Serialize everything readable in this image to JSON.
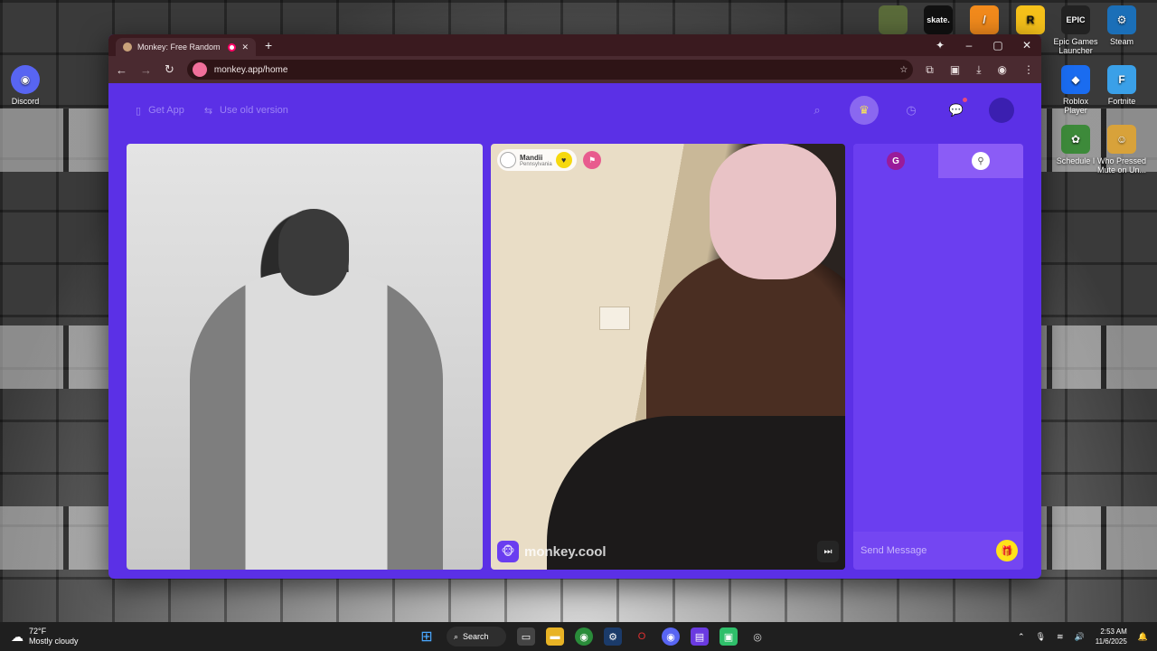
{
  "desktop": {
    "icons_left": [
      {
        "label": "Discord",
        "icon": "discord-icon",
        "color": "#5865f2"
      }
    ],
    "icons_right_top": [
      {
        "label": "",
        "icon": "game-thumbnail-icon",
        "color": "#5a6b3a"
      },
      {
        "label": "",
        "icon": "skate-icon",
        "color": "#111111"
      },
      {
        "label": "",
        "icon": "orange-game-icon",
        "color": "#f28a1c"
      },
      {
        "label": "",
        "icon": "rockstar-icon",
        "color": "#f6c11a"
      },
      {
        "label": "Epic Games Launcher",
        "icon": "epic-games-icon",
        "color": "#222222"
      },
      {
        "label": "Steam",
        "icon": "steam-icon",
        "color": "#1b6fb8"
      }
    ],
    "icons_right_mid": [
      {
        "label": "Roblox Player",
        "icon": "roblox-icon",
        "color": "#1a6cf0"
      },
      {
        "label": "Fortnite",
        "icon": "fortnite-icon",
        "color": "#3aa0e8"
      }
    ],
    "icons_right_low": [
      {
        "label": "Schedule I",
        "icon": "schedule-icon",
        "color": "#3d8a3a"
      },
      {
        "label": "Who Pressed Mute on Un...",
        "icon": "mute-game-icon",
        "color": "#d8a23a"
      }
    ]
  },
  "browser": {
    "tab_title": "Monkey: Free Random Vid",
    "new_tab_glyph": "+",
    "url": "monkey.app/home",
    "window_controls": {
      "minimize": "–",
      "maximize": "▢",
      "close": "✕"
    }
  },
  "app": {
    "header": {
      "get_app": "Get App",
      "old_version": "Use old version"
    },
    "remote_user": {
      "name": "Mandii",
      "location": "Pennsylvania"
    },
    "brand": "monkey.cool",
    "chat": {
      "tab_letter": "G",
      "placeholder": "Send Message"
    },
    "colors": {
      "accent": "#5b30e6",
      "gift": "#ffe21a"
    }
  },
  "taskbar": {
    "temperature": "72°F",
    "weather": "Mostly cloudy",
    "search": "Search",
    "time": "2:53 AM",
    "date": "11/6/2025"
  }
}
